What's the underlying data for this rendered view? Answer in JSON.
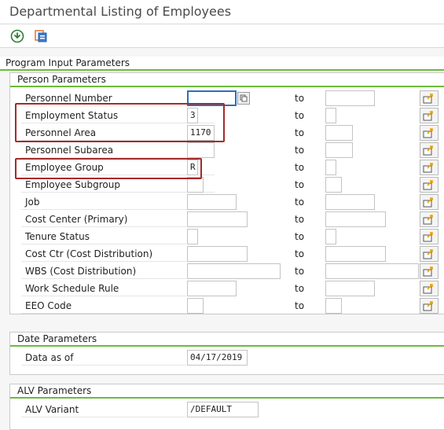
{
  "window": {
    "title": "Departmental Listing of Employees"
  },
  "toolbar": {
    "buttons": [
      {
        "name": "execute-icon"
      },
      {
        "name": "get-variant-icon"
      }
    ]
  },
  "program_input": {
    "title": "Program Input Parameters"
  },
  "person_params": {
    "title": "Person Parameters",
    "rows": [
      {
        "label": "Personnel Number",
        "from": "",
        "to_label": "to",
        "to": ""
      },
      {
        "label": "Employment Status",
        "from": "3",
        "to_label": "to",
        "to": ""
      },
      {
        "label": "Personnel Area",
        "from": "1170",
        "to_label": "to",
        "to": ""
      },
      {
        "label": "Personnel Subarea",
        "from": "",
        "to_label": "to",
        "to": ""
      },
      {
        "label": "Employee Group",
        "from": "R",
        "to_label": "to",
        "to": ""
      },
      {
        "label": "Employee Subgroup",
        "from": "",
        "to_label": "to",
        "to": ""
      },
      {
        "label": "Job",
        "from": "",
        "to_label": "to",
        "to": ""
      },
      {
        "label": "Cost Center (Primary)",
        "from": "",
        "to_label": "to",
        "to": ""
      },
      {
        "label": "Tenure Status",
        "from": "",
        "to_label": "to",
        "to": ""
      },
      {
        "label": "Cost Ctr (Cost Distribution)",
        "from": "",
        "to_label": "to",
        "to": ""
      },
      {
        "label": "WBS (Cost Distribution)",
        "from": "",
        "to_label": "to",
        "to": ""
      },
      {
        "label": "Work Schedule Rule",
        "from": "",
        "to_label": "to",
        "to": ""
      },
      {
        "label": "EEO Code",
        "from": "",
        "to_label": "to",
        "to": ""
      }
    ]
  },
  "date_params": {
    "title": "Date Parameters",
    "data_as_of_label": "Data as of",
    "data_as_of_value": "04/17/2019"
  },
  "alv_params": {
    "title": "ALV Parameters",
    "alv_variant_label": "ALV Variant",
    "alv_variant_value": "/DEFAULT"
  },
  "colors": {
    "accent_green": "#6cbb3c",
    "highlight_red": "#a42a2a",
    "focus_blue": "#2a6fbe"
  }
}
